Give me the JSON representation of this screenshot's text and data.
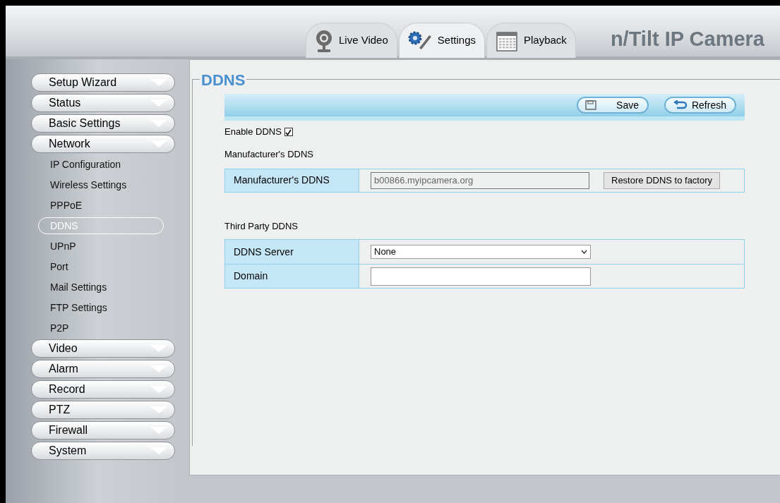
{
  "header": {
    "title": "n/Tilt IP Camera",
    "tabs": [
      {
        "label": "Live Video",
        "kind": "camera",
        "selected": false
      },
      {
        "label": "Settings",
        "kind": "gears",
        "selected": true
      },
      {
        "label": "Playback",
        "kind": "calendar",
        "selected": false
      }
    ]
  },
  "sidebar": {
    "items": [
      {
        "label": "Setup Wizard"
      },
      {
        "label": "Status"
      },
      {
        "label": "Basic Settings"
      },
      {
        "label": "Network",
        "children": [
          {
            "label": "IP Configuration",
            "selected": false
          },
          {
            "label": "Wireless Settings",
            "selected": false
          },
          {
            "label": "PPPoE",
            "selected": false
          },
          {
            "label": "DDNS",
            "selected": true
          },
          {
            "label": "UPnP",
            "selected": false
          },
          {
            "label": "Port",
            "selected": false
          },
          {
            "label": "Mail Settings",
            "selected": false
          },
          {
            "label": "FTP Settings",
            "selected": false
          },
          {
            "label": "P2P",
            "selected": false
          }
        ]
      },
      {
        "label": "Video"
      },
      {
        "label": "Alarm"
      },
      {
        "label": "Record"
      },
      {
        "label": "PTZ"
      },
      {
        "label": "Firewall"
      },
      {
        "label": "System"
      }
    ]
  },
  "panel": {
    "title": "DDNS",
    "buttons": [
      {
        "label": "Save",
        "kind": "save"
      },
      {
        "label": "Refresh",
        "kind": "refresh"
      }
    ],
    "enable": {
      "label": "Enable DDNS",
      "checked": true
    },
    "manufacturer": {
      "heading": "Manufacturer's DDNS",
      "label": "Manufacturer's DDNS",
      "value": "b00866.myipcamera.org",
      "button": "Restore DDNS to factory"
    },
    "third_party": {
      "heading": "Third Party DDNS",
      "rows": [
        {
          "label": "DDNS Server",
          "kind": "select",
          "value": "None"
        },
        {
          "label": "Domain",
          "kind": "text"
        }
      ]
    }
  }
}
